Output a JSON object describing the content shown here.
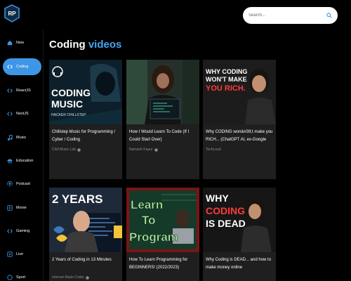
{
  "brand": {
    "logo_text": "RP"
  },
  "search": {
    "placeholder": "Search..."
  },
  "sidebar": {
    "items": [
      {
        "label": "New",
        "icon": "home-icon",
        "active": false
      },
      {
        "label": "Coding",
        "icon": "code-icon",
        "active": true
      },
      {
        "label": "ReactJS",
        "icon": "code-icon",
        "active": false
      },
      {
        "label": "NextJS",
        "icon": "code-icon",
        "active": false
      },
      {
        "label": "Music",
        "icon": "music-icon",
        "active": false
      },
      {
        "label": "Education",
        "icon": "education-icon",
        "active": false
      },
      {
        "label": "Podcast",
        "icon": "podcast-icon",
        "active": false
      },
      {
        "label": "Movie",
        "icon": "movie-icon",
        "active": false
      },
      {
        "label": "Gaming",
        "icon": "gaming-icon",
        "active": false
      },
      {
        "label": "Live",
        "icon": "live-icon",
        "active": false
      },
      {
        "label": "Sport",
        "icon": "sport-icon",
        "active": false
      }
    ]
  },
  "main": {
    "title_word": "Coding",
    "title_suffix": "videos",
    "videos": [
      {
        "title": "Chillstep Music for Programming / Cyber / Coding",
        "channel": "Chill Music Lab",
        "thumb_text": [
          "CODING",
          "MUSIC"
        ],
        "thumb_sub": "HACKER CHILLSTEP"
      },
      {
        "title": "How I Would Learn To Code (If I Could Start Over)",
        "channel": "Namanh Kapur"
      },
      {
        "title": "Why CODING won&#39;t make you RICH... (ChatGPT AI, ex-Google",
        "channel": "TechLead",
        "thumb_text": [
          "WHY CODING",
          "WON'T MAKE",
          "YOU RICH."
        ]
      },
      {
        "title": "2 Years of Coding in 13 Minutes",
        "channel": "Internet Made Coder",
        "thumb_text": [
          "2 YEARS"
        ]
      },
      {
        "title": "How To Learn Programming for BEGINNERS! (2022/2023)",
        "channel": "",
        "thumb_text": [
          "Learn",
          "To",
          "Program"
        ]
      },
      {
        "title": "Why Coding is DEAD... and how to make money online",
        "channel": "",
        "thumb_text": [
          "WHY",
          "CODING",
          "IS DEAD"
        ]
      }
    ]
  },
  "colors": {
    "accent": "#3d97e6",
    "title_accent": "#43a6f2",
    "card_bg": "#1f1f1f"
  }
}
